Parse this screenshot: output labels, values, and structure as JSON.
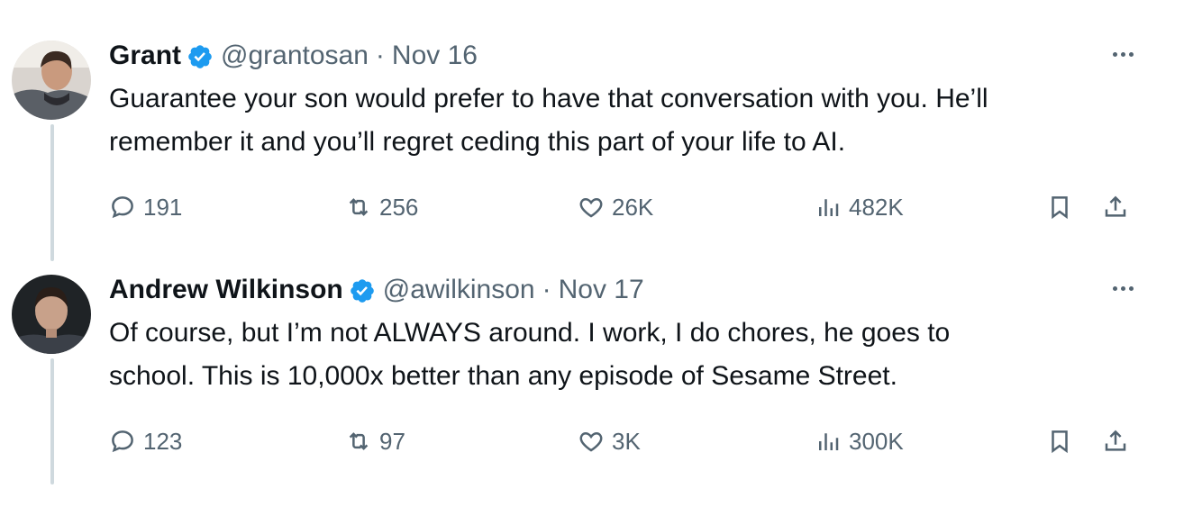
{
  "tweets": [
    {
      "name": "Grant",
      "handle": "@grantosan",
      "separator": "·",
      "date": "Nov 16",
      "text_lines": [
        "Guarantee your son would prefer to have that conversation with you. He’ll",
        "remember it and you’ll regret ceding this part of your life to AI."
      ],
      "stats": {
        "replies": "191",
        "reposts": "256",
        "likes": "26K",
        "views": "482K"
      }
    },
    {
      "name": "Andrew Wilkinson",
      "handle": "@awilkinson",
      "separator": "·",
      "date": "Nov 17",
      "text_lines": [
        "Of course, but I’m not ALWAYS around. I work, I do chores, he goes to",
        "school. This is 10,000x better than any episode of Sesame Street."
      ],
      "stats": {
        "replies": "123",
        "reposts": "97",
        "likes": "3K",
        "views": "300K"
      }
    }
  ],
  "colors": {
    "verified": "#1d9bf0",
    "muted": "#536471",
    "text": "#0f1419",
    "thread_line": "#cfd9de"
  },
  "icons": [
    "verified-badge-icon",
    "more-icon",
    "reply-icon",
    "repost-icon",
    "like-icon",
    "views-icon",
    "bookmark-icon",
    "share-icon"
  ]
}
